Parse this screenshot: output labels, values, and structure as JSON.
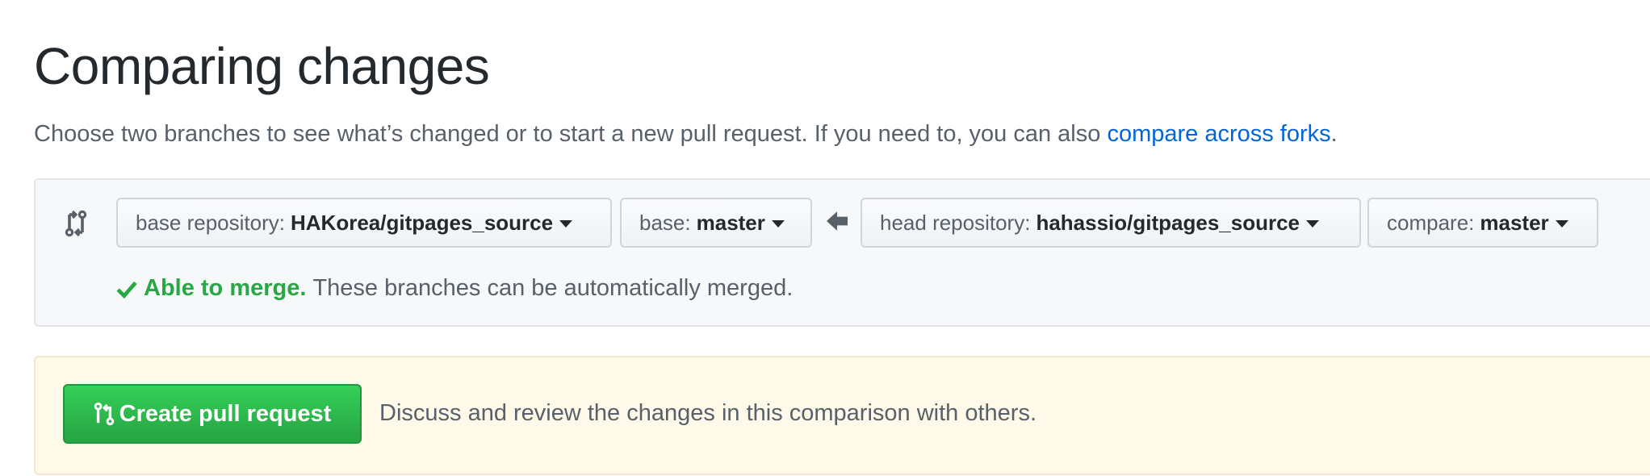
{
  "page": {
    "title": "Comparing changes",
    "subtitle_text": "Choose two branches to see what’s changed or to start a new pull request. If you need to, you can also ",
    "subtitle_link": "compare across forks",
    "subtitle_end": "."
  },
  "range": {
    "base_repo_label": "base repository:",
    "base_repo_value": "HAKorea/gitpages_source",
    "base_label": "base:",
    "base_value": "master",
    "head_repo_label": "head repository:",
    "head_repo_value": "hahassio/gitpages_source",
    "compare_label": "compare:",
    "compare_value": "master"
  },
  "merge": {
    "status": "Able to merge.",
    "message": "These branches can be automatically merged."
  },
  "pull_request": {
    "button_label": "Create pull request",
    "description": "Discuss and review the changes in this comparison with others."
  },
  "icons": {
    "range": "git-compare-icon",
    "direction": "arrow-left-icon",
    "status": "check-icon",
    "pr": "git-pull-request-icon"
  },
  "colors": {
    "link": "#0366d6",
    "success": "#28a745",
    "button_green": "#2ea44f",
    "notice_bg": "#fff9ea"
  }
}
